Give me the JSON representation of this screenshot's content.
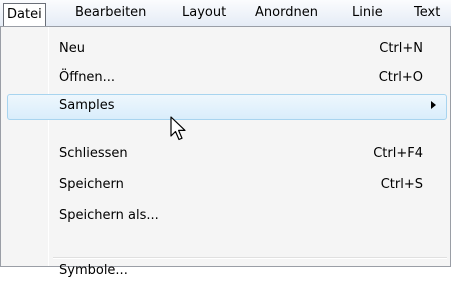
{
  "menubar": {
    "items": [
      {
        "label": "Datei"
      },
      {
        "label": "Bearbeiten"
      },
      {
        "label": "Layout"
      },
      {
        "label": "Anordnen"
      },
      {
        "label": "Linie"
      },
      {
        "label": "Text"
      }
    ]
  },
  "menu": {
    "items": [
      {
        "label": "Neu",
        "shortcut": "Ctrl+N"
      },
      {
        "label": "Öffnen...",
        "shortcut": "Ctrl+O"
      },
      {
        "label": "Samples",
        "shortcut": "",
        "submenu": true
      },
      {
        "label": "Schliessen",
        "shortcut": "Ctrl+F4"
      },
      {
        "label": "Speichern",
        "shortcut": "Ctrl+S"
      },
      {
        "label": "Speichern als...",
        "shortcut": ""
      },
      {
        "label": "Symbole...",
        "shortcut": ""
      }
    ],
    "highlighted_item": "Samples"
  },
  "colors": {
    "highlight_border": "#a8d4ef",
    "highlight_fill": "#d9edfb",
    "menu_background": "#f5f5f5"
  },
  "icons": {
    "submenu": "chevron-right-icon",
    "pointer": "mouse-cursor-icon"
  }
}
